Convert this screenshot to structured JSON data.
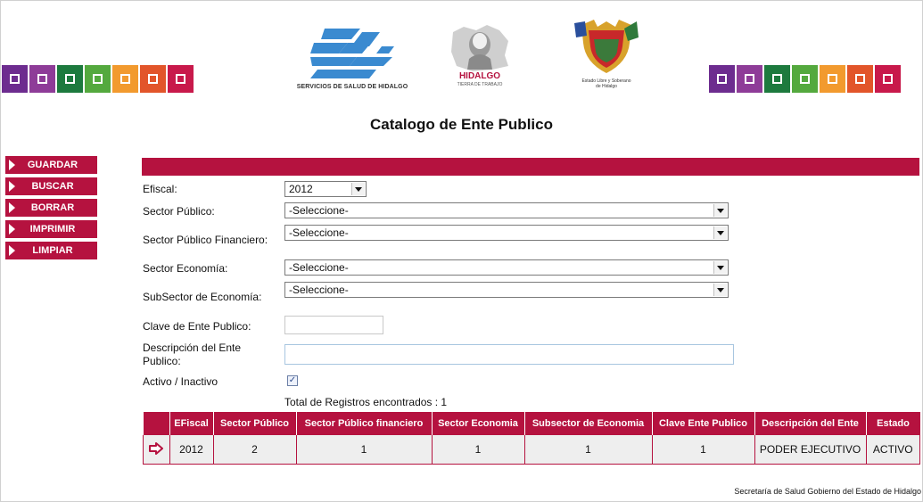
{
  "colors": {
    "accent": "#b5123f",
    "squares_left": [
      "#6d2c8f",
      "#8e3c98",
      "#1d7a3e",
      "#54a93e",
      "#f29a2e",
      "#e2552a",
      "#c8194b"
    ],
    "squares_right": [
      "#6d2c8f",
      "#8e3c98",
      "#1d7a3e",
      "#54a93e",
      "#f29a2e",
      "#e2552a",
      "#c8194b"
    ]
  },
  "header": {
    "ssh_caption": "SERVICIOS DE SALUD DE HIDALGO",
    "hidalgo_caption": "HIDALGO",
    "hidalgo_tagline": "TIERRA DE TRABAJO",
    "shield_caption_1": "Estado Libre y Soberano",
    "shield_caption_2": "de Hidalgo"
  },
  "page_title": "Catalogo de Ente Publico",
  "menu": {
    "guardar": "GUARDAR",
    "buscar": "BUSCAR",
    "borrar": "BORRAR",
    "imprimir": "IMPRIMIR",
    "limpiar": "LIMPIAR"
  },
  "form": {
    "efiscal_label": "Efiscal:",
    "efiscal_value": "2012",
    "sector_publico_label": "Sector Público:",
    "sector_publico_value": "-Seleccione-",
    "sector_publico_fin_label": "Sector Público Financiero:",
    "sector_publico_fin_value": "-Seleccione-",
    "sector_economia_label": "Sector Economía:",
    "sector_economia_value": "-Seleccione-",
    "subsector_label": "SubSector de Economía:",
    "subsector_value": "-Seleccione-",
    "clave_label": "Clave de Ente Publico:",
    "descripcion_label_1": "Descripción del Ente",
    "descripcion_label_2": "Publico:",
    "activo_label": "Activo / Inactivo",
    "activo_checked": "✓"
  },
  "results": {
    "total_text": "Total de Registros encontrados : 1"
  },
  "table": {
    "headers": [
      "EFiscal",
      "Sector Público",
      "Sector Público financiero",
      "Sector Economia",
      "Subsector de Economia",
      "Clave Ente Publico",
      "Descripción del Ente",
      "Estado"
    ],
    "rows": [
      [
        "2012",
        "2",
        "1",
        "1",
        "1",
        "1",
        "PODER EJECUTIVO",
        "ACTIVO"
      ]
    ]
  },
  "footer": "Secretaría de Salud Gobierno del Estado de Hidalgo"
}
